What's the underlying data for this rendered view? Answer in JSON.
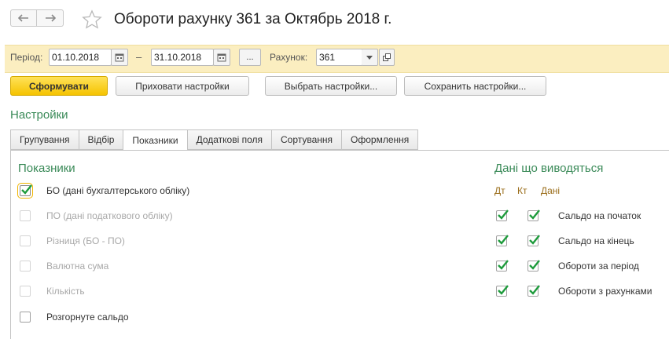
{
  "window": {
    "title": "Обороти рахунку 361 за Октябрь 2018 г.",
    "back_icon": "arrow-left-icon",
    "forward_icon": "arrow-right-icon",
    "favorite_icon": "star-icon"
  },
  "params": {
    "period_label": "Період:",
    "date_from": "01.10.2018",
    "dash": "–",
    "date_to": "31.10.2018",
    "period_button": "...",
    "account_label": "Рахунок:",
    "account_value": "361"
  },
  "toolbar": {
    "generate": "Сформувати",
    "hide_settings": "Приховати настройки",
    "choose_settings": "Выбрать настройки...",
    "save_settings": "Сохранить настройки..."
  },
  "settings_title": "Настройки",
  "tabs": [
    {
      "label": "Групування",
      "active": false
    },
    {
      "label": "Відбір",
      "active": false
    },
    {
      "label": "Показники",
      "active": true
    },
    {
      "label": "Додаткові поля",
      "active": false
    },
    {
      "label": "Сортування",
      "active": false
    },
    {
      "label": "Оформлення",
      "active": false
    }
  ],
  "indicators": {
    "title": "Показники",
    "items": [
      {
        "label": "БО (дані бухгалтерського обліку)",
        "checked": true,
        "enabled": true
      },
      {
        "label": "ПО (дані податкового обліку)",
        "checked": false,
        "enabled": false
      },
      {
        "label": "Різниця (БО - ПО)",
        "checked": false,
        "enabled": false
      },
      {
        "label": "Валютна сума",
        "checked": false,
        "enabled": false
      },
      {
        "label": "Кількість",
        "checked": false,
        "enabled": false
      },
      {
        "label": "Розгорнуте сальдо",
        "checked": false,
        "enabled": true
      }
    ]
  },
  "output": {
    "title": "Дані що виводяться",
    "col_dt": "Дт",
    "col_kt": "Кт",
    "col_data": "Дані",
    "rows": [
      {
        "label": "Сальдо на початок",
        "dt": true,
        "kt": true
      },
      {
        "label": "Сальдо на кінець",
        "dt": true,
        "kt": true
      },
      {
        "label": "Обороти за період",
        "dt": true,
        "kt": true
      },
      {
        "label": "Обороти з рахунками",
        "dt": true,
        "kt": true
      }
    ]
  },
  "colors": {
    "accent_green": "#3a8a58",
    "check_green": "#1e9b3c",
    "highlight_yellow": "#fbeec0",
    "primary_button": "#f5c300",
    "column_header": "#9a6d1a"
  }
}
